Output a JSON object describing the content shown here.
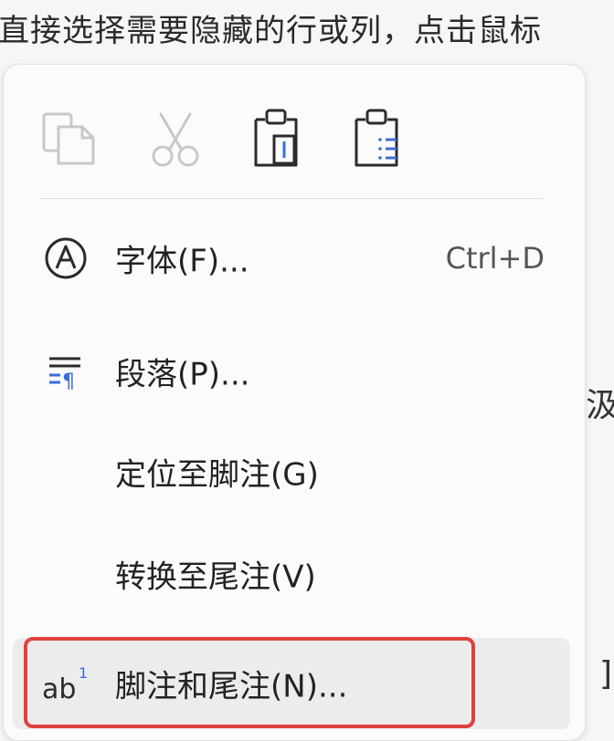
{
  "document": {
    "top_line": "直接选择需要隐藏的行或列，点击鼠标",
    "right_edge_char": "汲",
    "right_edge_char2": "]"
  },
  "toolbar": {
    "copy_icon": "copy-icon",
    "cut_icon": "cut-icon",
    "paste_icon": "paste-icon",
    "paste_text_icon": "paste-text-only-icon"
  },
  "menu": {
    "items": [
      {
        "label": "字体(F)...",
        "shortcut": "Ctrl+D",
        "icon": "font-a-circle-icon"
      },
      {
        "label": "段落(P)...",
        "shortcut": "",
        "icon": "paragraph-icon"
      },
      {
        "label": "定位至脚注(G)",
        "shortcut": "",
        "icon": ""
      },
      {
        "label": "转换至尾注(V)",
        "shortcut": "",
        "icon": ""
      },
      {
        "label": "脚注和尾注(N)...",
        "shortcut": "",
        "icon": "footnote-ab1-icon",
        "highlighted": true
      }
    ]
  },
  "colors": {
    "highlight_border": "#e0413c",
    "menu_bg": "#fbfbfb",
    "icon_dark": "#2b2b2b",
    "icon_disabled": "#c8c8c8",
    "icon_accent": "#3a6fd8"
  }
}
